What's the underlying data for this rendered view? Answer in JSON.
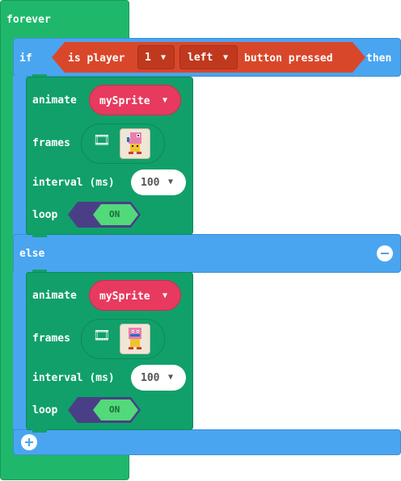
{
  "forever": {
    "label": "forever"
  },
  "if_block": {
    "if_label": "if",
    "then_label": "then",
    "else_label": "else",
    "condition": {
      "prefix": "is player",
      "player_value": "1",
      "direction_value": "left",
      "suffix": "button pressed"
    }
  },
  "animate_blocks": [
    {
      "animate_label": "animate",
      "sprite_value": "mySprite",
      "frames_label": "frames",
      "interval_label": "interval (ms)",
      "interval_value": "100",
      "loop_label": "loop",
      "loop_toggle": "ON"
    },
    {
      "animate_label": "animate",
      "sprite_value": "mySprite",
      "frames_label": "frames",
      "interval_label": "interval (ms)",
      "interval_value": "100",
      "loop_label": "loop",
      "loop_toggle": "ON"
    }
  ],
  "icons": {
    "dropdown": "▼",
    "film": "🎞",
    "remove": "remove-else-icon",
    "add": "add-else-icon"
  },
  "colors": {
    "forever": "#1fb86a",
    "logic": "#4aa5f0",
    "condition": "#d9472b",
    "animation": "#11a06a",
    "sprite": "#e73a5e",
    "toggle_on": "#52d97a",
    "toggle_track": "#4a3f86"
  }
}
